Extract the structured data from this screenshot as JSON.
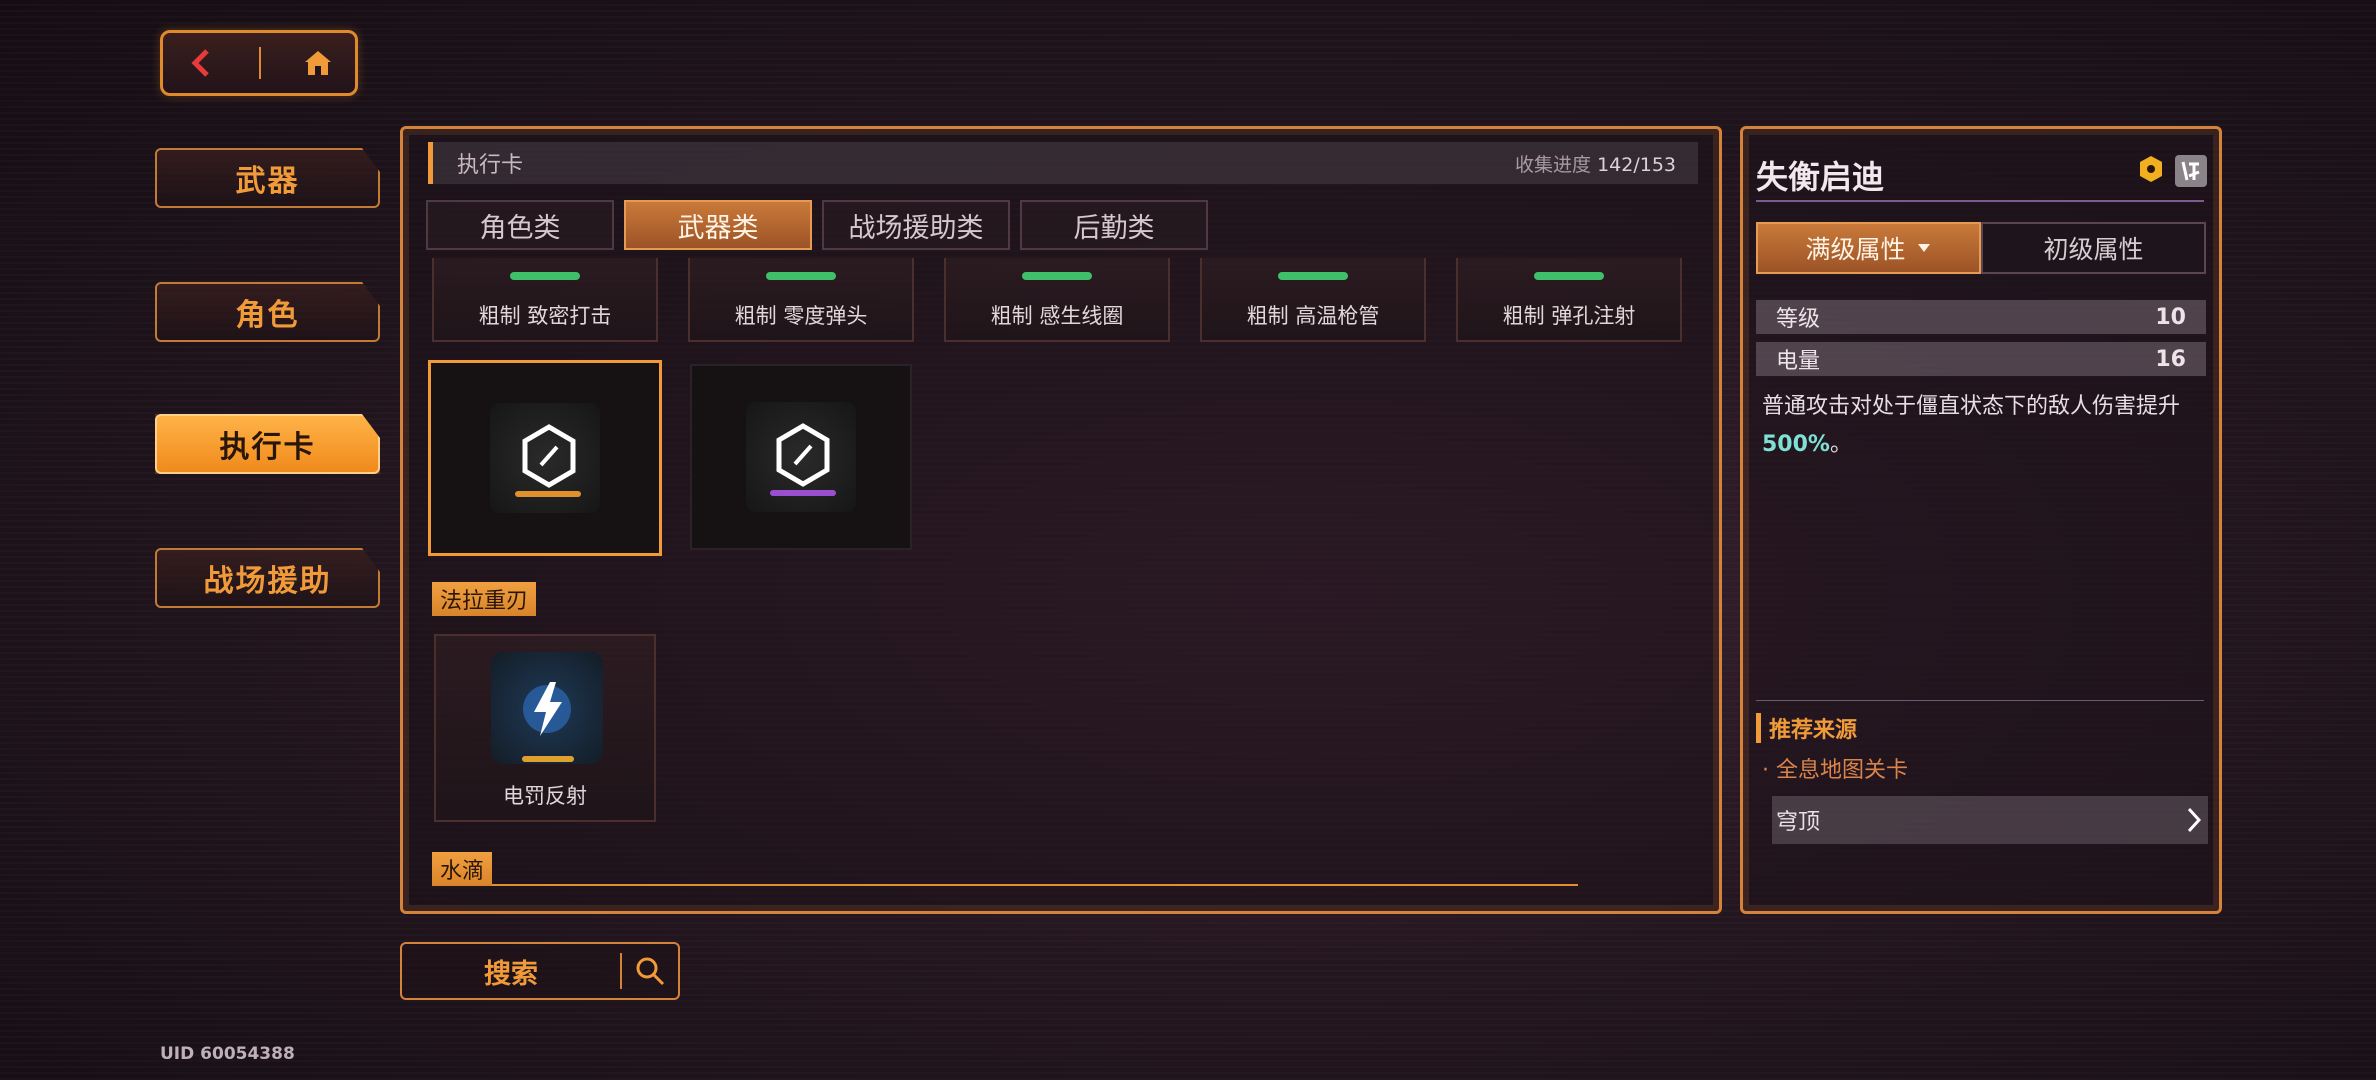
{
  "uid": "UID 60054388",
  "left_menu": [
    {
      "label": "武器",
      "active": false
    },
    {
      "label": "角色",
      "active": false
    },
    {
      "label": "执行卡",
      "active": true
    },
    {
      "label": "战场援助",
      "active": false
    }
  ],
  "panel": {
    "title": "执行卡",
    "progress_label": "收集进度",
    "progress_value": "142/153",
    "tabs": [
      {
        "label": "角色类",
        "active": false
      },
      {
        "label": "武器类",
        "active": true
      },
      {
        "label": "战场援助类",
        "active": false
      },
      {
        "label": "后勤类",
        "active": false
      }
    ],
    "top_cards": [
      {
        "name": "粗制 致密打击"
      },
      {
        "name": "粗制 零度弹头"
      },
      {
        "name": "粗制 感生线圈"
      },
      {
        "name": "粗制 高温枪管"
      },
      {
        "name": "粗制 弹孔注射"
      }
    ],
    "section1_label": "法拉重刃",
    "section1_card": {
      "name": "电罚反射"
    },
    "section2_label": "水滴"
  },
  "search": {
    "label": "搜索"
  },
  "detail": {
    "title": "失衡启迪",
    "toggle": [
      {
        "label": "满级属性",
        "active": true
      },
      {
        "label": "初级属性",
        "active": false
      }
    ],
    "stats": [
      {
        "label": "等级",
        "value": "10"
      },
      {
        "label": "电量",
        "value": "16"
      }
    ],
    "desc_prefix": "普通攻击对处于僵直状态下的敌人伤害提升",
    "desc_highlight": "500%",
    "desc_suffix": "。",
    "rec_title": "推荐来源",
    "rec_sub": "· 全息地图关卡",
    "rec_item": "穹顶"
  },
  "colors": {
    "accent": "#f09a3a",
    "highlight": "#7fe0d4",
    "bar_green": "#3fbf6a"
  }
}
